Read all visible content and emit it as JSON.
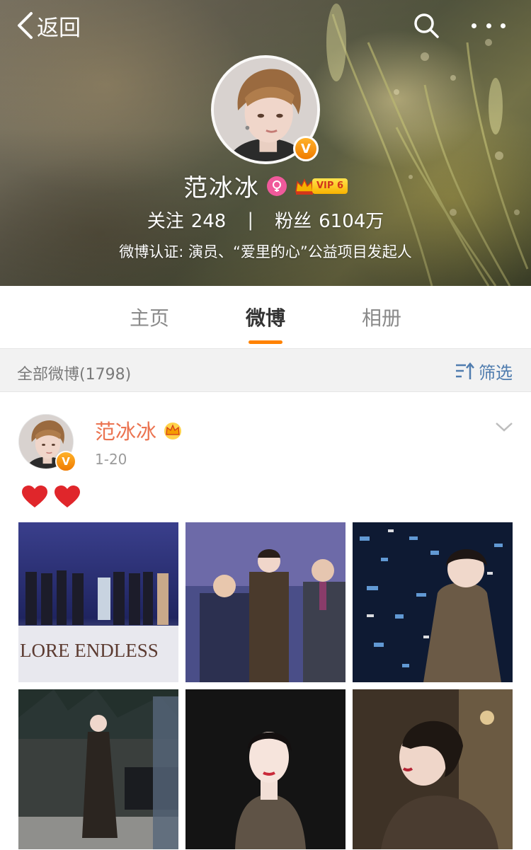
{
  "nav": {
    "back_label": "返回",
    "search_icon": "search-icon",
    "more_icon": "more-icon"
  },
  "profile": {
    "name": "范冰冰",
    "gender_icon": "female-icon",
    "vip_label": "VIP 6",
    "verified_icon": "verified-v-icon",
    "following_label": "关注",
    "following_count": "248",
    "stat_divider": "|",
    "followers_label": "粉丝",
    "followers_count": "6104万",
    "verification": "微博认证: 演员、“爱里的心”公益项目发起人"
  },
  "tabs": [
    {
      "label": "主页",
      "active": false
    },
    {
      "label": "微博",
      "active": true
    },
    {
      "label": "相册",
      "active": false
    }
  ],
  "filter": {
    "count_label": "全部微博(1798)",
    "filter_label": "筛选",
    "filter_icon": "filter-sort-icon"
  },
  "post": {
    "author": "范冰冰",
    "author_badge_icon": "vip-crown-icon",
    "time": "1-20",
    "text_icons": [
      "heart-icon",
      "heart-icon"
    ],
    "menu_icon": "chevron-down-icon",
    "photo_count": 6,
    "photo_banner_text": "LORE ENDLESS"
  },
  "colors": {
    "accent_orange": "#ff8200",
    "author_name": "#eb7350",
    "link_blue": "#507daf",
    "filter_bg": "#f2f2f2",
    "verified_badge": "#f5a300"
  }
}
